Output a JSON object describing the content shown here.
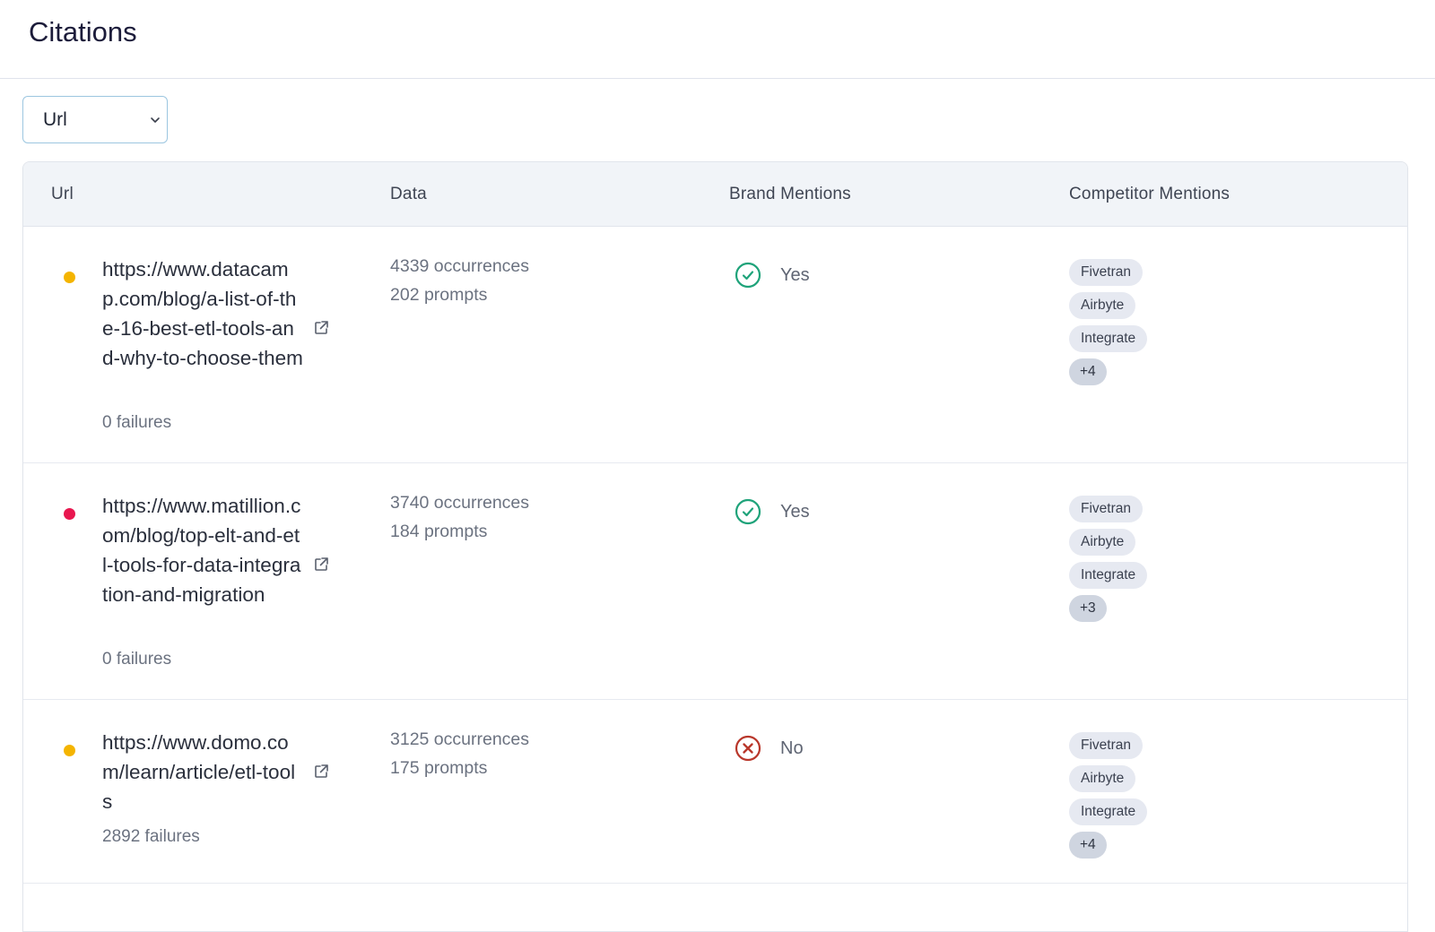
{
  "page": {
    "title": "Citations"
  },
  "filter": {
    "selected": "Url"
  },
  "table": {
    "headers": [
      "Url",
      "Data",
      "Brand Mentions",
      "Competitor Mentions"
    ],
    "rows": [
      {
        "status_color": "#f4b400",
        "url": "https://www.datacamp.com/blog/a-list-of-the-16-best-etl-tools-and-why-to-choose-them",
        "failures": "0 failures",
        "occurrences": "4339 occurrences",
        "prompts": "202 prompts",
        "brand_mention": "Yes",
        "brand_icon": "check-circle-icon",
        "competitors": [
          "Fivetran",
          "Airbyte",
          "Integrate"
        ],
        "more": "+4"
      },
      {
        "status_color": "#e8174f",
        "url": "https://www.matillion.com/blog/top-elt-and-etl-tools-for-data-integration-and-migration",
        "failures": "0 failures",
        "occurrences": "3740 occurrences",
        "prompts": "184 prompts",
        "brand_mention": "Yes",
        "brand_icon": "check-circle-icon",
        "competitors": [
          "Fivetran",
          "Airbyte",
          "Integrate"
        ],
        "more": "+3"
      },
      {
        "status_color": "#f4b400",
        "url": "https://www.domo.com/learn/article/etl-tools",
        "failures": "2892 failures",
        "occurrences": "3125 occurrences",
        "prompts": "175 prompts",
        "brand_mention": "No",
        "brand_icon": "x-circle-icon",
        "competitors": [
          "Fivetran",
          "Airbyte",
          "Integrate"
        ],
        "more": "+4"
      }
    ]
  },
  "colors": {
    "yes": "#1fa37a",
    "no": "#b9372b",
    "accent_border": "#9cc6e0"
  }
}
